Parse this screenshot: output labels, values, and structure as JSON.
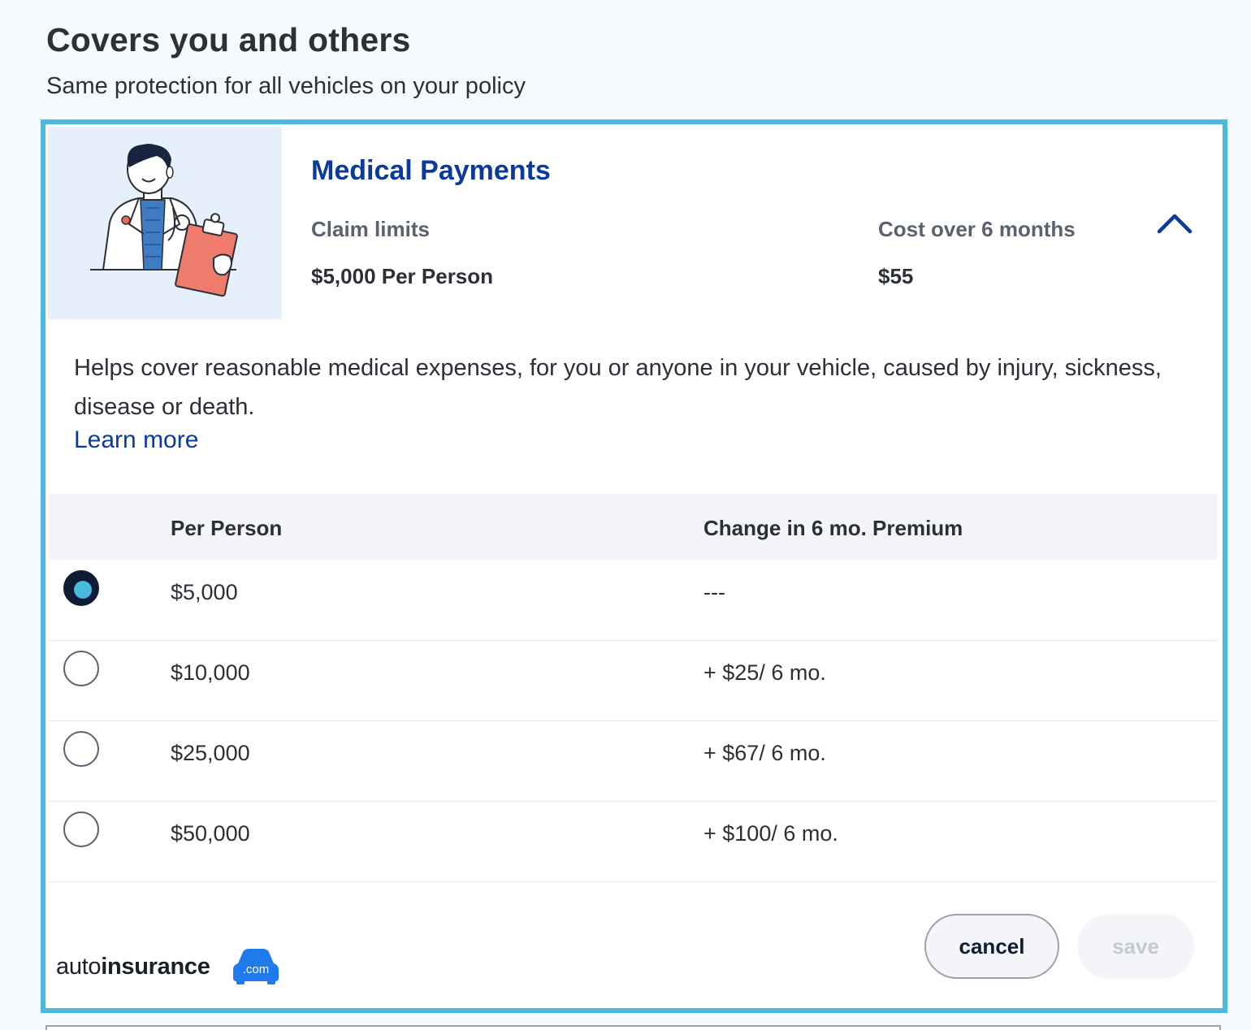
{
  "section": {
    "title": "Covers you and others",
    "subtitle": "Same protection for all vehicles on your policy"
  },
  "coverage": {
    "name": "Medical Payments",
    "claim_limits_label": "Claim limits",
    "claim_limits_value": "$5,000 Per Person",
    "cost_label": "Cost over 6 months",
    "cost_value": "$55",
    "description": "Helps cover reasonable medical expenses, for you or anyone in your vehicle, caused by injury, sickness, disease or death.",
    "learn_more": "Learn more",
    "illustration_icon": "doctor-with-clipboard",
    "collapse_icon": "chevron-up-icon"
  },
  "table": {
    "headers": [
      "Per Person",
      "Change in 6 mo. Premium"
    ],
    "rows": [
      {
        "limit": "$5,000",
        "change": "---",
        "selected": true
      },
      {
        "limit": "$10,000",
        "change": "+ $25/ 6 mo.",
        "selected": false
      },
      {
        "limit": "$25,000",
        "change": "+ $67/ 6 mo.",
        "selected": false
      },
      {
        "limit": "$50,000",
        "change": "+ $100/ 6 mo.",
        "selected": false
      }
    ]
  },
  "actions": {
    "cancel": "cancel",
    "save": "save"
  },
  "watermark": {
    "brand_light": "auto",
    "brand_bold": "insurance",
    "brand_badge": ".com"
  },
  "colors": {
    "accent_border": "#4bb8e0",
    "brand_blue": "#0b3a9e",
    "radio_selected": "#0f1c33",
    "logo_blue": "#1f7aec"
  }
}
